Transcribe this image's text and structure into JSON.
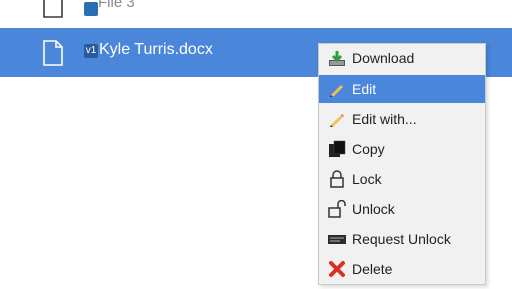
{
  "file_list": {
    "rows": [
      {
        "name": "File 3",
        "badge": "v1"
      },
      {
        "name": "Kyle Turris.docx",
        "badge": "v1"
      }
    ]
  },
  "context_menu": {
    "items": [
      {
        "label": "Download",
        "icon": "download-icon"
      },
      {
        "label": "Edit",
        "icon": "pencil-icon",
        "active": true
      },
      {
        "label": "Edit with...",
        "icon": "pencil-icon"
      },
      {
        "label": "Copy",
        "icon": "copy-icon"
      },
      {
        "label": "Lock",
        "icon": "lock-icon"
      },
      {
        "label": "Unlock",
        "icon": "unlock-icon"
      },
      {
        "label": "Request Unlock",
        "icon": "request-unlock-icon"
      },
      {
        "label": "Delete",
        "icon": "delete-icon"
      }
    ]
  },
  "colors": {
    "selection": "#4a86d9",
    "menu_background": "#f1f1f1",
    "delete_icon": "#d93025",
    "download_arrow": "#2e9e3f"
  }
}
